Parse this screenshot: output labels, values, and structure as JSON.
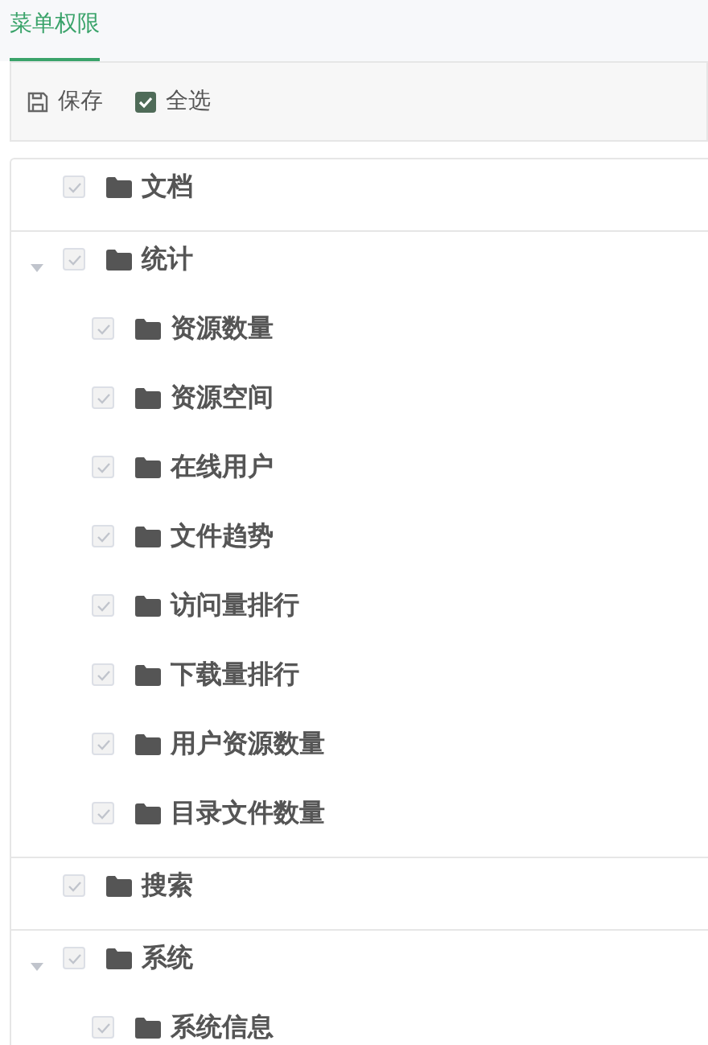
{
  "tabs": [
    {
      "label": "菜单权限",
      "selected": true
    }
  ],
  "toolbar": {
    "save": {
      "label": "保存"
    },
    "select_all": {
      "label": "全选",
      "checked": true
    }
  },
  "tree": [
    {
      "label": "文档",
      "checked": true,
      "disabled": true
    },
    {
      "label": "统计",
      "checked": true,
      "disabled": true,
      "expanded": true,
      "children": [
        {
          "label": "资源数量",
          "checked": true,
          "disabled": true
        },
        {
          "label": "资源空间",
          "checked": true,
          "disabled": true
        },
        {
          "label": "在线用户",
          "checked": true,
          "disabled": true
        },
        {
          "label": "文件趋势",
          "checked": true,
          "disabled": true
        },
        {
          "label": "访问量排行",
          "checked": true,
          "disabled": true
        },
        {
          "label": "下载量排行",
          "checked": true,
          "disabled": true
        },
        {
          "label": "用户资源数量",
          "checked": true,
          "disabled": true
        },
        {
          "label": "目录文件数量",
          "checked": true,
          "disabled": true
        }
      ]
    },
    {
      "label": "搜索",
      "checked": true,
      "disabled": true
    },
    {
      "label": "系统",
      "checked": true,
      "disabled": true,
      "expanded": true,
      "children": [
        {
          "label": "系统信息",
          "checked": true,
          "disabled": true
        }
      ]
    }
  ]
}
